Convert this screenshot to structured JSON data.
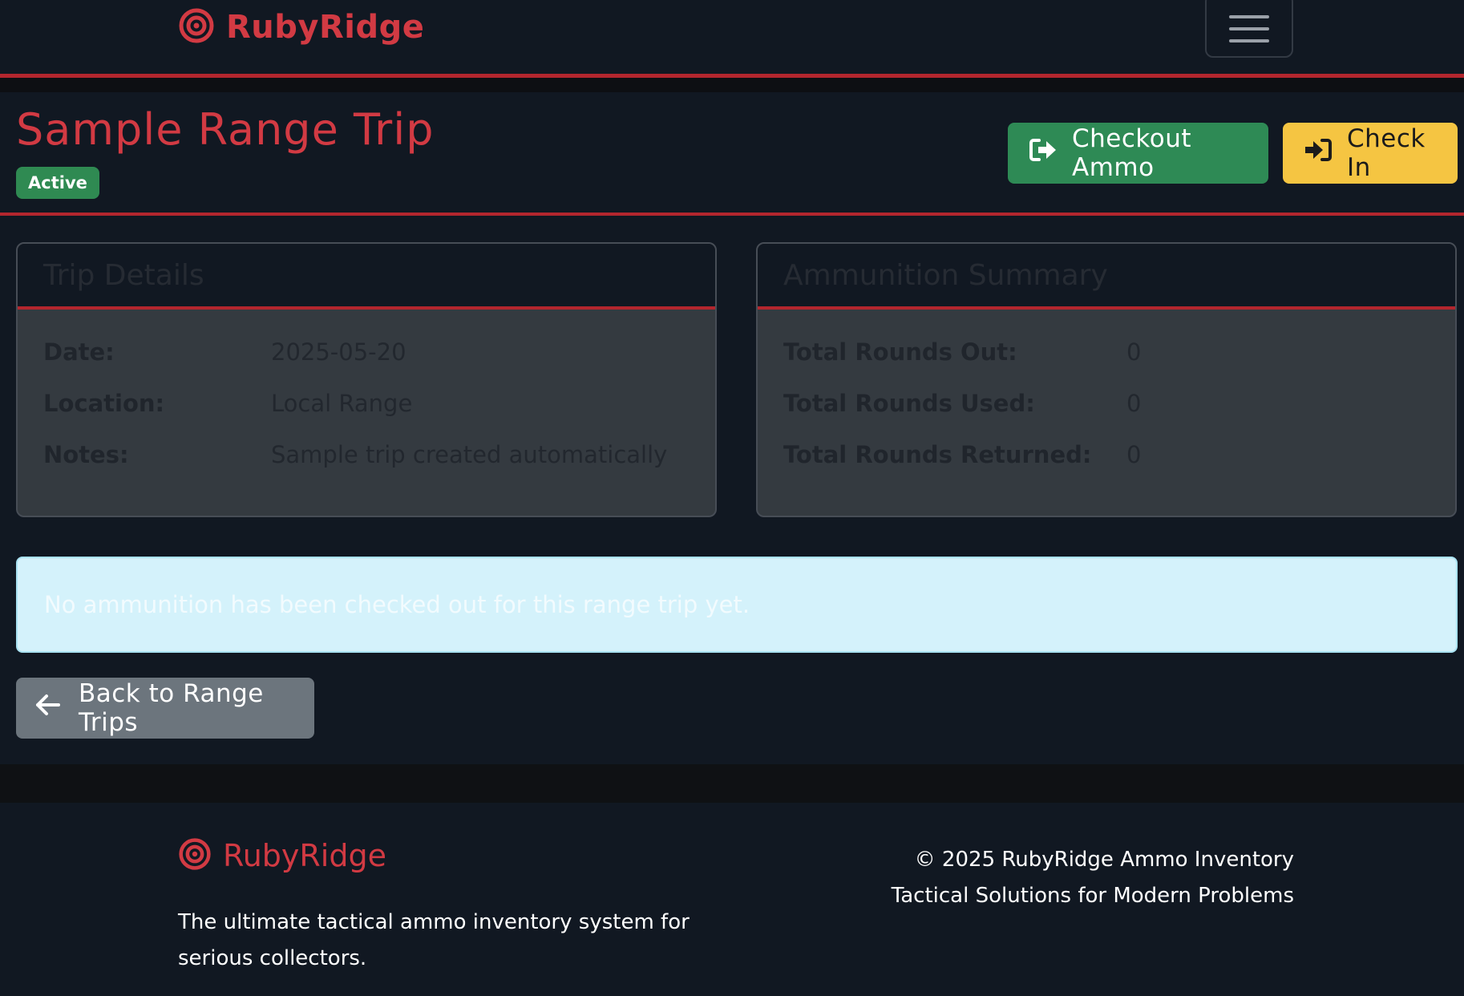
{
  "navbar": {
    "brand": "RubyRidge",
    "menu_icon": "hamburger-icon"
  },
  "header": {
    "title": "Sample Range Trip",
    "status": "Active",
    "checkout_label": "Checkout Ammo",
    "checkin_label": "Check In"
  },
  "trip_details": {
    "title": "Trip Details",
    "rows": [
      {
        "label": "Date:",
        "value": "2025-05-20"
      },
      {
        "label": "Location:",
        "value": "Local Range"
      },
      {
        "label": "Notes:",
        "value": "Sample trip created automatically"
      }
    ]
  },
  "ammo_summary": {
    "title": "Ammunition Summary",
    "rows": [
      {
        "label": "Total Rounds Out:",
        "value": "0"
      },
      {
        "label": "Total Rounds Used:",
        "value": "0"
      },
      {
        "label": "Total Rounds Returned:",
        "value": "0"
      }
    ]
  },
  "alert": {
    "message": "No ammunition has been checked out for this range trip yet."
  },
  "back_button": {
    "label": "Back to Range Trips"
  },
  "footer": {
    "brand": "RubyRidge",
    "description": "The ultimate tactical ammo inventory system for serious collectors.",
    "copyright": "© 2025 RubyRidge Ammo Inventory",
    "tagline": "Tactical Solutions for Modern Problems"
  },
  "colors": {
    "accent": "#d23a43",
    "success": "#2e8a55",
    "warning": "#f5c542",
    "secondary": "#6c757d",
    "info_bg": "#d4f2fb"
  }
}
